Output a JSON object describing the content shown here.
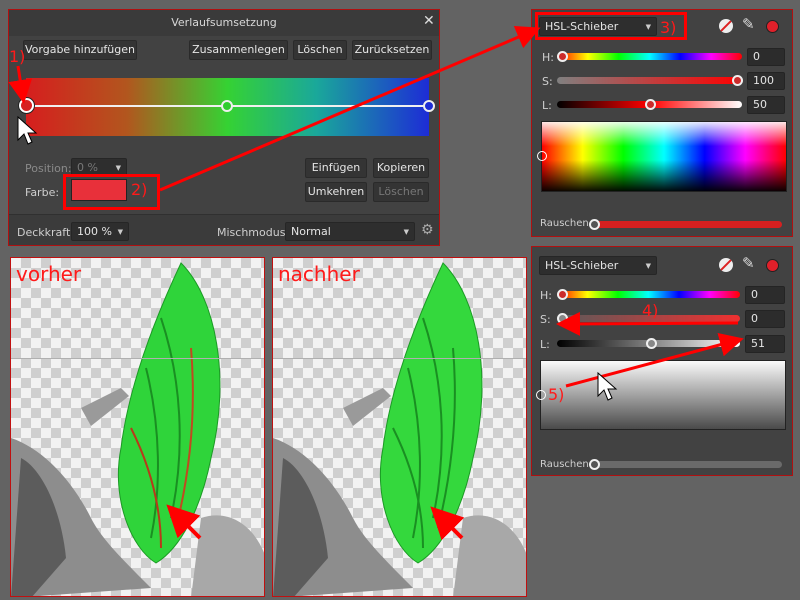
{
  "gradient_map": {
    "title": "Verlaufsumsetzung",
    "add_preset": "Vorgabe hinzufügen",
    "merge": "Zusammenlegen",
    "delete": "Löschen",
    "reset": "Zurücksetzen",
    "position_label": "Position:",
    "position_value": "0 %",
    "color_label": "Farbe:",
    "insert": "Einfügen",
    "copy": "Kopieren",
    "reverse": "Umkehren",
    "delete_stop": "Löschen",
    "opacity_label": "Deckkraft:",
    "opacity_value": "100 %",
    "blend_label": "Mischmodus:",
    "blend_value": "Normal",
    "selected_color": "#e8303a"
  },
  "color_panel_top": {
    "mode": "HSL-Schieber",
    "h_label": "H:",
    "h_value": "0",
    "s_label": "S:",
    "s_value": "100",
    "l_label": "L:",
    "l_value": "50",
    "noise_label": "Rauschen",
    "swatch_color": "#e0202a"
  },
  "color_panel_bottom": {
    "mode": "HSL-Schieber",
    "h_label": "H:",
    "h_value": "0",
    "s_label": "S:",
    "s_value": "0",
    "l_label": "L:",
    "l_value": "51",
    "noise_label": "Rauschen",
    "swatch_color": "#e0202a"
  },
  "annotations": {
    "step1": "1)",
    "step2": "2)",
    "step3": "3)",
    "step4": "4)",
    "step5": "5)",
    "before": "vorher",
    "after": "nachher"
  },
  "colors": {
    "accent_red": "#ff0000",
    "panel_bg": "#424242"
  }
}
